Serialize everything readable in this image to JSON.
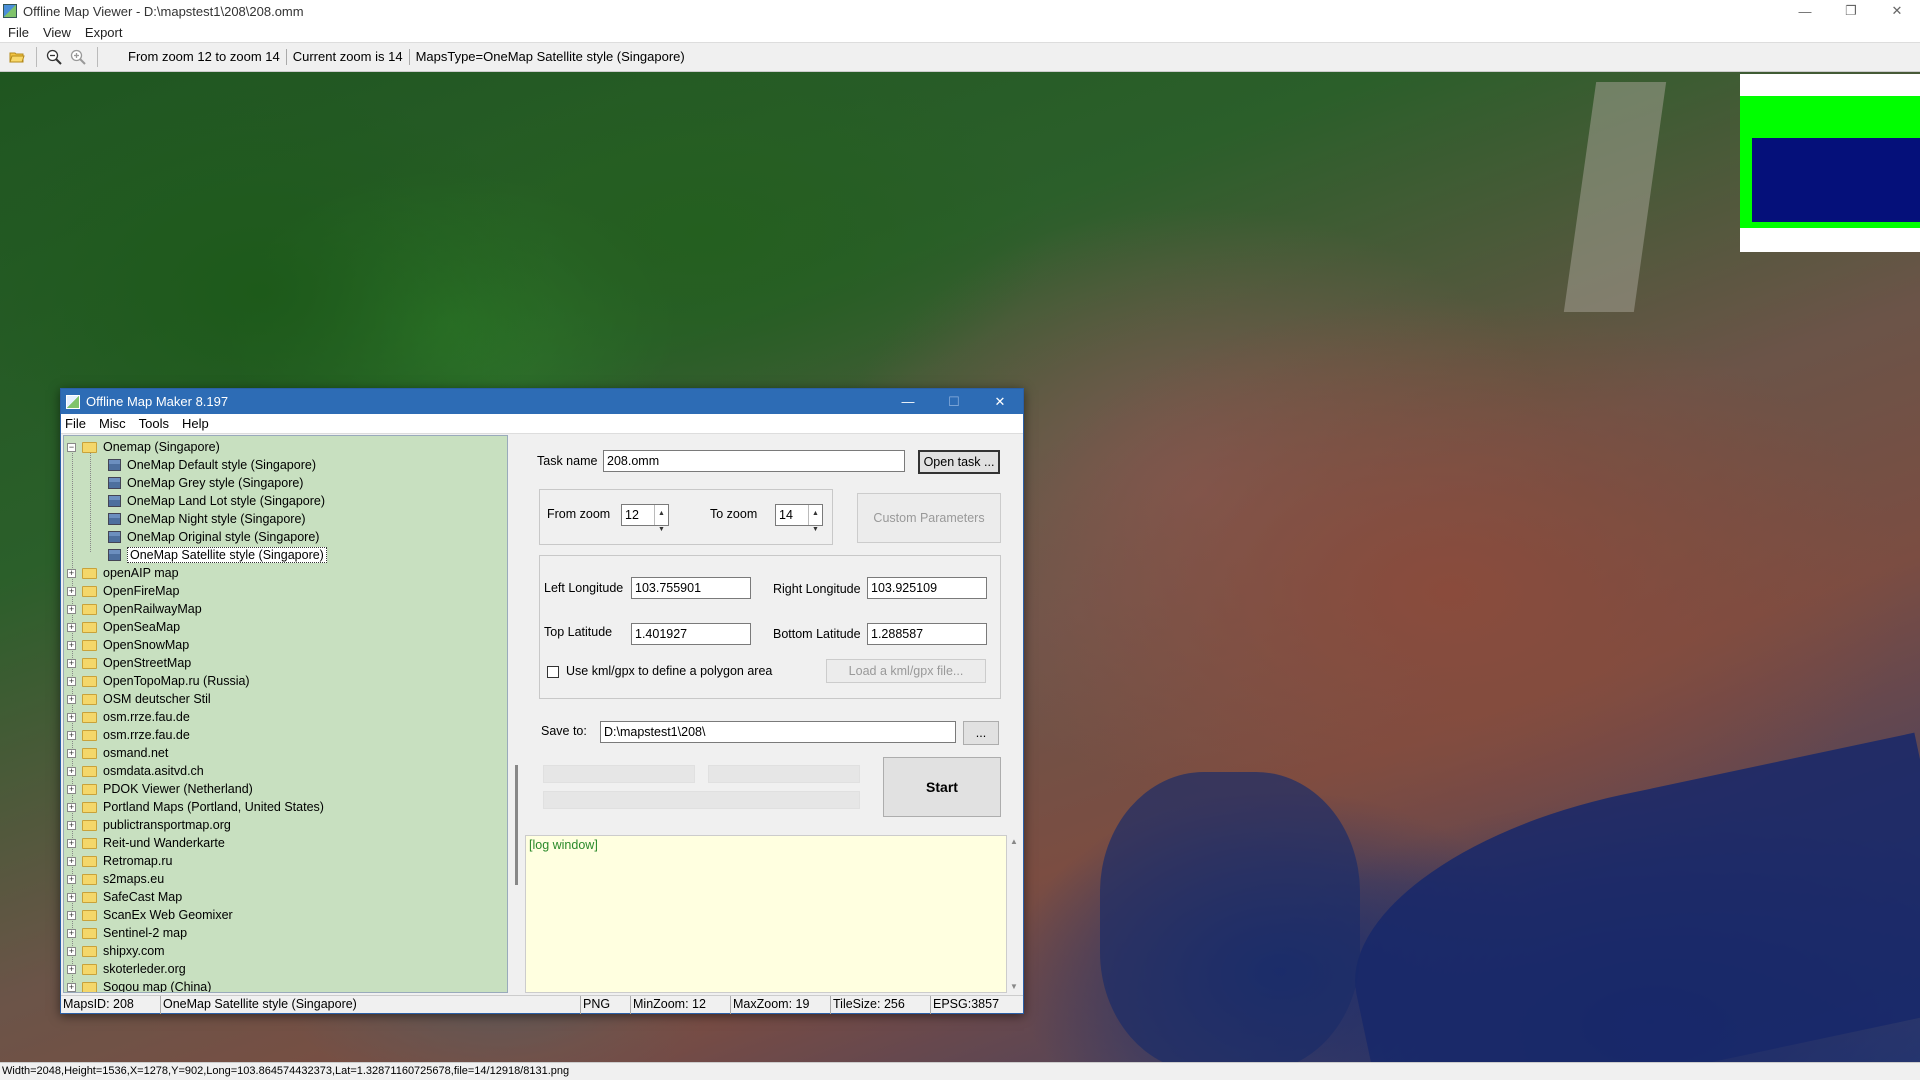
{
  "window": {
    "title": "Offline Map Viewer - D:\\mapstest1\\208\\208.omm",
    "controls": {
      "minimize": "—",
      "restore": "❐",
      "close": "✕"
    }
  },
  "menubar": {
    "items": [
      "File",
      "View",
      "Export"
    ]
  },
  "toolbar": {
    "icons": [
      "folder-open-icon",
      "zoom-out-icon",
      "zoom-in-icon"
    ],
    "zoom_range": "From zoom 12 to zoom 14",
    "current_zoom": "Current zoom is 14",
    "maps_type": "MapsType=OneMap Satellite style (Singapore)"
  },
  "statusbar": {
    "text": "Width=2048,Height=1536,X=1278,Y=902,Long=103.864574432373,Lat=1.32871160725678,file=14/12918/8131.png"
  },
  "overview": {
    "colors": {
      "frame": "#00ff00",
      "viewport": "#05107a"
    }
  },
  "dialog": {
    "title": "Offline Map Maker 8.197",
    "controls": {
      "minimize": "—",
      "maximize": "☐",
      "close": "✕"
    },
    "menu": [
      "File",
      "Misc",
      "Tools",
      "Help"
    ],
    "tree": {
      "expanded_folder": "Onemap (Singapore)",
      "children": [
        "OneMap Default style (Singapore)",
        "OneMap Grey style (Singapore)",
        "OneMap Land Lot style (Singapore)",
        "OneMap Night style (Singapore)",
        "OneMap Original style (Singapore)",
        "OneMap Satellite style (Singapore)"
      ],
      "selected": "OneMap Satellite style (Singapore)",
      "folders": [
        "openAIP map",
        "OpenFireMap",
        "OpenRailwayMap",
        "OpenSeaMap",
        "OpenSnowMap",
        "OpenStreetMap",
        "OpenTopoMap.ru (Russia)",
        "OSM deutscher Stil",
        "osm.rrze.fau.de",
        "osm.rrze.fau.de",
        "osmand.net",
        "osmdata.asitvd.ch",
        "PDOK Viewer (Netherland)",
        "Portland Maps (Portland, United States)",
        "publictransportmap.org",
        "Reit-und Wanderkarte",
        "Retromap.ru",
        "s2maps.eu",
        "SafeCast Map",
        "ScanEx Web Geomixer",
        "Sentinel-2 map",
        "shipxy.com",
        "skoterleder.org",
        "Sogou map (China)"
      ]
    },
    "task": {
      "label": "Task name",
      "value": "208.omm",
      "open_button": "Open task ..."
    },
    "zoom": {
      "from_label": "From zoom",
      "from_value": "12",
      "to_label": "To zoom",
      "to_value": "14",
      "custom_button": "Custom Parameters"
    },
    "bounds": {
      "left_label": "Left Longitude",
      "left_value": "103.755901",
      "right_label": "Right Longitude",
      "right_value": "103.925109",
      "top_label": "Top Latitude",
      "top_value": "1.401927",
      "bottom_label": "Bottom Latitude",
      "bottom_value": "1.288587",
      "kml_label": "Use kml/gpx to define a polygon area",
      "kml_checked": false,
      "kml_button": "Load a kml/gpx file..."
    },
    "save": {
      "label": "Save to:",
      "value": "D:\\mapstest1\\208\\",
      "browse_button": "..."
    },
    "start_button": "Start",
    "log": {
      "text": "[log window]"
    },
    "status": {
      "maps_id": "MapsID: 208",
      "maps_name": "OneMap Satellite style (Singapore)",
      "format": "PNG",
      "min_zoom": "MinZoom: 12",
      "max_zoom": "MaxZoom: 19",
      "tile_size": "TileSize: 256",
      "epsg": "EPSG:3857"
    }
  }
}
